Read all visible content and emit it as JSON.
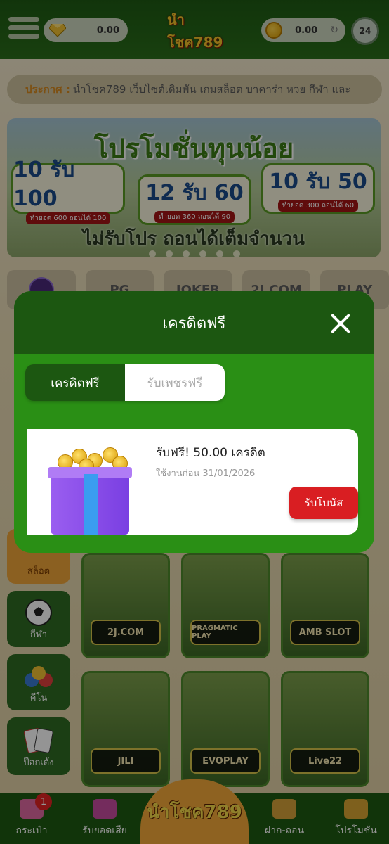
{
  "header": {
    "diamond_balance": "0.00",
    "coin_balance": "0.00",
    "logo_text": "นำโชค789",
    "avatar_text": "24"
  },
  "announcement": {
    "label": "ประกาศ :",
    "text": "นำโชค789 เว็บไซต์เดิมพัน เกมสล็อต บาคาร่า หวย กีฬา และ"
  },
  "banner": {
    "title": "โปรโมชั่นทุนน้อย",
    "promos": [
      {
        "nums": "10 รับ 100",
        "sub": "ทำยอด 600 ถอนได้ 100"
      },
      {
        "nums": "12 รับ 60",
        "sub": "ทำยอด 360 ถอนได้ 90"
      },
      {
        "nums": "10 รับ 50",
        "sub": "ทำยอด 300 ถอนได้ 60"
      }
    ],
    "footer": "ไม่รับโปร ถอนได้เต็มจำนวน"
  },
  "providers": [
    "PG",
    "JOKER",
    "2J.COM",
    "PLAY"
  ],
  "side_categories": [
    {
      "label": "สล็อต"
    },
    {
      "label": "กีฬา"
    },
    {
      "label": "คีโน"
    },
    {
      "label": "ป๊อกเด้ง"
    }
  ],
  "games": [
    {
      "brand": "2J.COM"
    },
    {
      "brand": "PRAGMATIC PLAY"
    },
    {
      "brand": "AMB SLOT"
    },
    {
      "brand": "JILI"
    },
    {
      "brand": "EVOPLAY"
    },
    {
      "brand": "Live22"
    }
  ],
  "modal": {
    "title": "เครดิตฟรี",
    "tabs": [
      {
        "label": "เครดิตฟรี",
        "active": true
      },
      {
        "label": "รับเพชรฟรี",
        "active": false
      }
    ],
    "bonus": {
      "title": "รับฟรี! 50.00 เครดิต",
      "expiry": "ใช้งานก่อน 31/01/2026",
      "claim_label": "รับโบนัส"
    }
  },
  "bottom_nav": {
    "items": [
      {
        "label": "กระเป๋า",
        "badge": "1"
      },
      {
        "label": "รับยอดเสีย"
      },
      {
        "label": "ฝาก-ถอน"
      },
      {
        "label": "โปรโมชั่น"
      }
    ],
    "center_logo": "นำโชค789"
  }
}
